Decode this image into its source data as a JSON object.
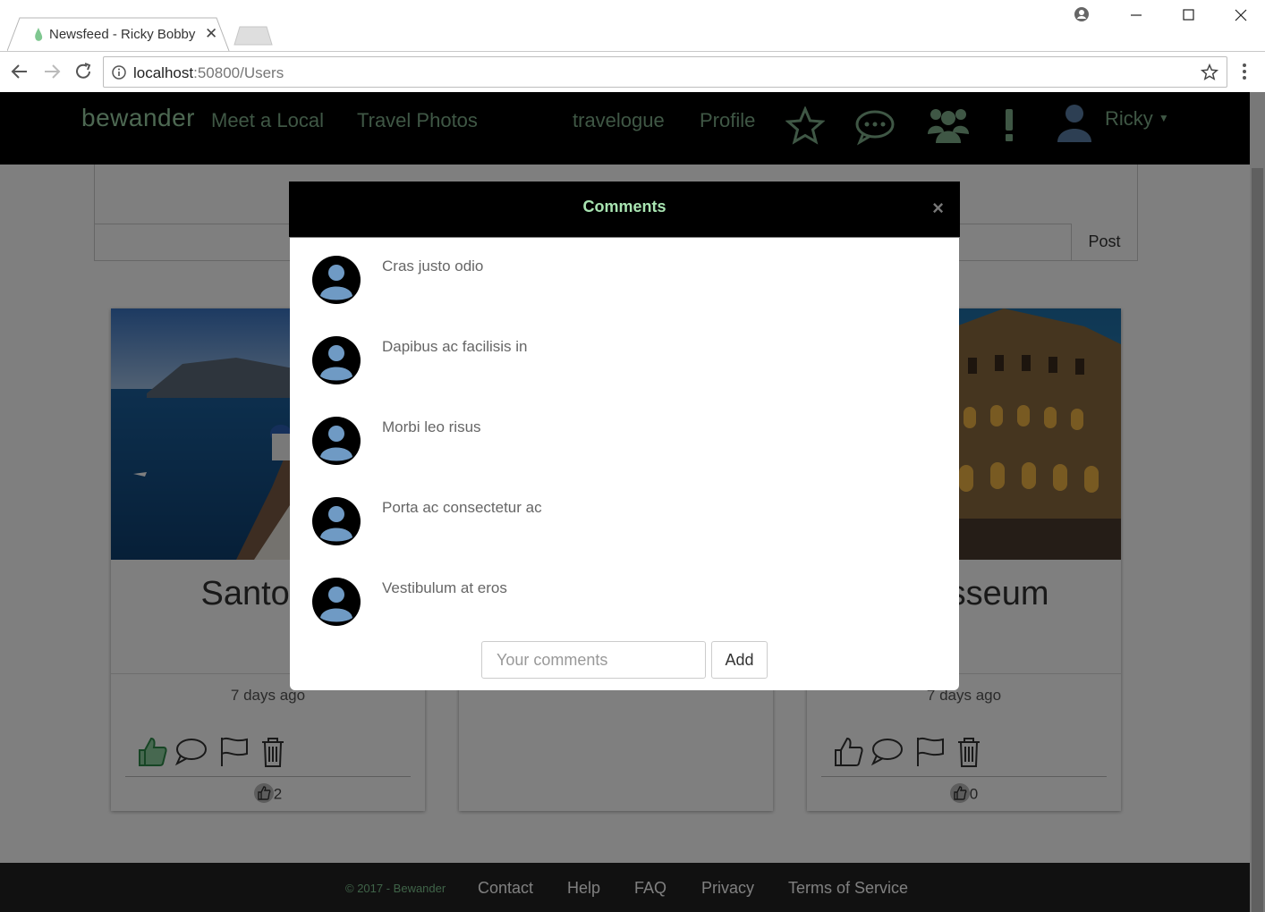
{
  "browser": {
    "tab_title": "Newsfeed - Ricky Bobby",
    "url_host": "localhost",
    "url_rest": ":50800/Users"
  },
  "nav": {
    "logo": "bewander",
    "meet_local": "Meet a Local",
    "travel_photos": "Travel Photos",
    "travelogue": "travelogue",
    "profile": "Profile",
    "user_name": "Ricky",
    "icons": [
      "star-icon",
      "chat-icon",
      "group-icon",
      "alert-icon",
      "avatar"
    ]
  },
  "post_box": {
    "post_label": "Post"
  },
  "cards": [
    {
      "title": "Santorini",
      "time": "7 days ago",
      "likes": "2",
      "liked": true
    },
    {
      "title": "",
      "time": "",
      "likes": "",
      "liked": false
    },
    {
      "title": "Colosseum",
      "time": "7 days ago",
      "likes": "0",
      "liked": false
    }
  ],
  "modal": {
    "title": "Comments",
    "close": "×",
    "comments": [
      "Cras justo odio",
      "Dapibus ac facilisis in",
      "Morbi leo risus",
      "Porta ac consectetur ac",
      "Vestibulum at eros"
    ],
    "input_placeholder": "Your comments",
    "add_label": "Add"
  },
  "footer": {
    "copyright": "© 2017 - Bewander",
    "links": [
      "Contact",
      "Help",
      "FAQ",
      "Privacy",
      "Terms of Service"
    ]
  },
  "colors": {
    "accent_green": "#7fae8a",
    "title_green": "#a8e4b1",
    "navbar_bg": "#000000",
    "footer_bg": "#222222"
  }
}
